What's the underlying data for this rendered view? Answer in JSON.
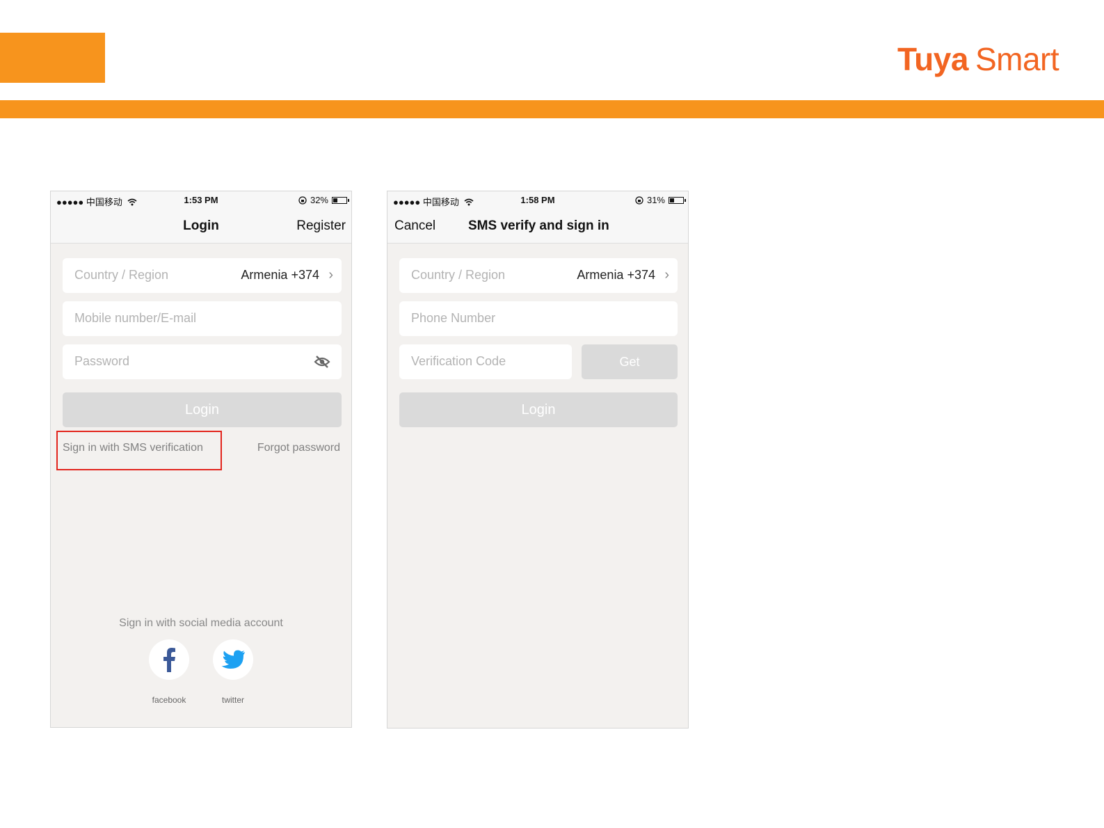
{
  "brand": {
    "name_bold": "Tuya",
    "name_regular": "Smart",
    "color": "#f26522",
    "accent": "#f7941d"
  },
  "login_screen": {
    "status": {
      "carrier": "●●●●● 中国移动",
      "time": "1:53 PM",
      "battery": "32%",
      "battery_level": 0.32
    },
    "nav": {
      "title": "Login",
      "right": "Register"
    },
    "country": {
      "placeholder": "Country / Region",
      "value": "Armenia +374"
    },
    "account": {
      "placeholder": "Mobile number/E-mail"
    },
    "password": {
      "placeholder": "Password"
    },
    "login_button": "Login",
    "sms_link": "Sign in with SMS verification",
    "forgot_link": "Forgot password",
    "social_title": "Sign in with social media account",
    "social": [
      {
        "label": "facebook",
        "icon": "facebook-icon",
        "color": "#3b5998"
      },
      {
        "label": "twitter",
        "icon": "twitter-icon",
        "color": "#1da1f2"
      }
    ]
  },
  "sms_screen": {
    "status": {
      "carrier": "●●●●● 中国移动",
      "time": "1:58 PM",
      "battery": "31%",
      "battery_level": 0.31
    },
    "nav": {
      "left": "Cancel",
      "title": "SMS verify and sign in"
    },
    "country": {
      "placeholder": "Country / Region",
      "value": "Armenia +374"
    },
    "phone": {
      "placeholder": "Phone Number"
    },
    "code": {
      "placeholder": "Verification Code"
    },
    "get_button": "Get",
    "login_button": "Login"
  }
}
